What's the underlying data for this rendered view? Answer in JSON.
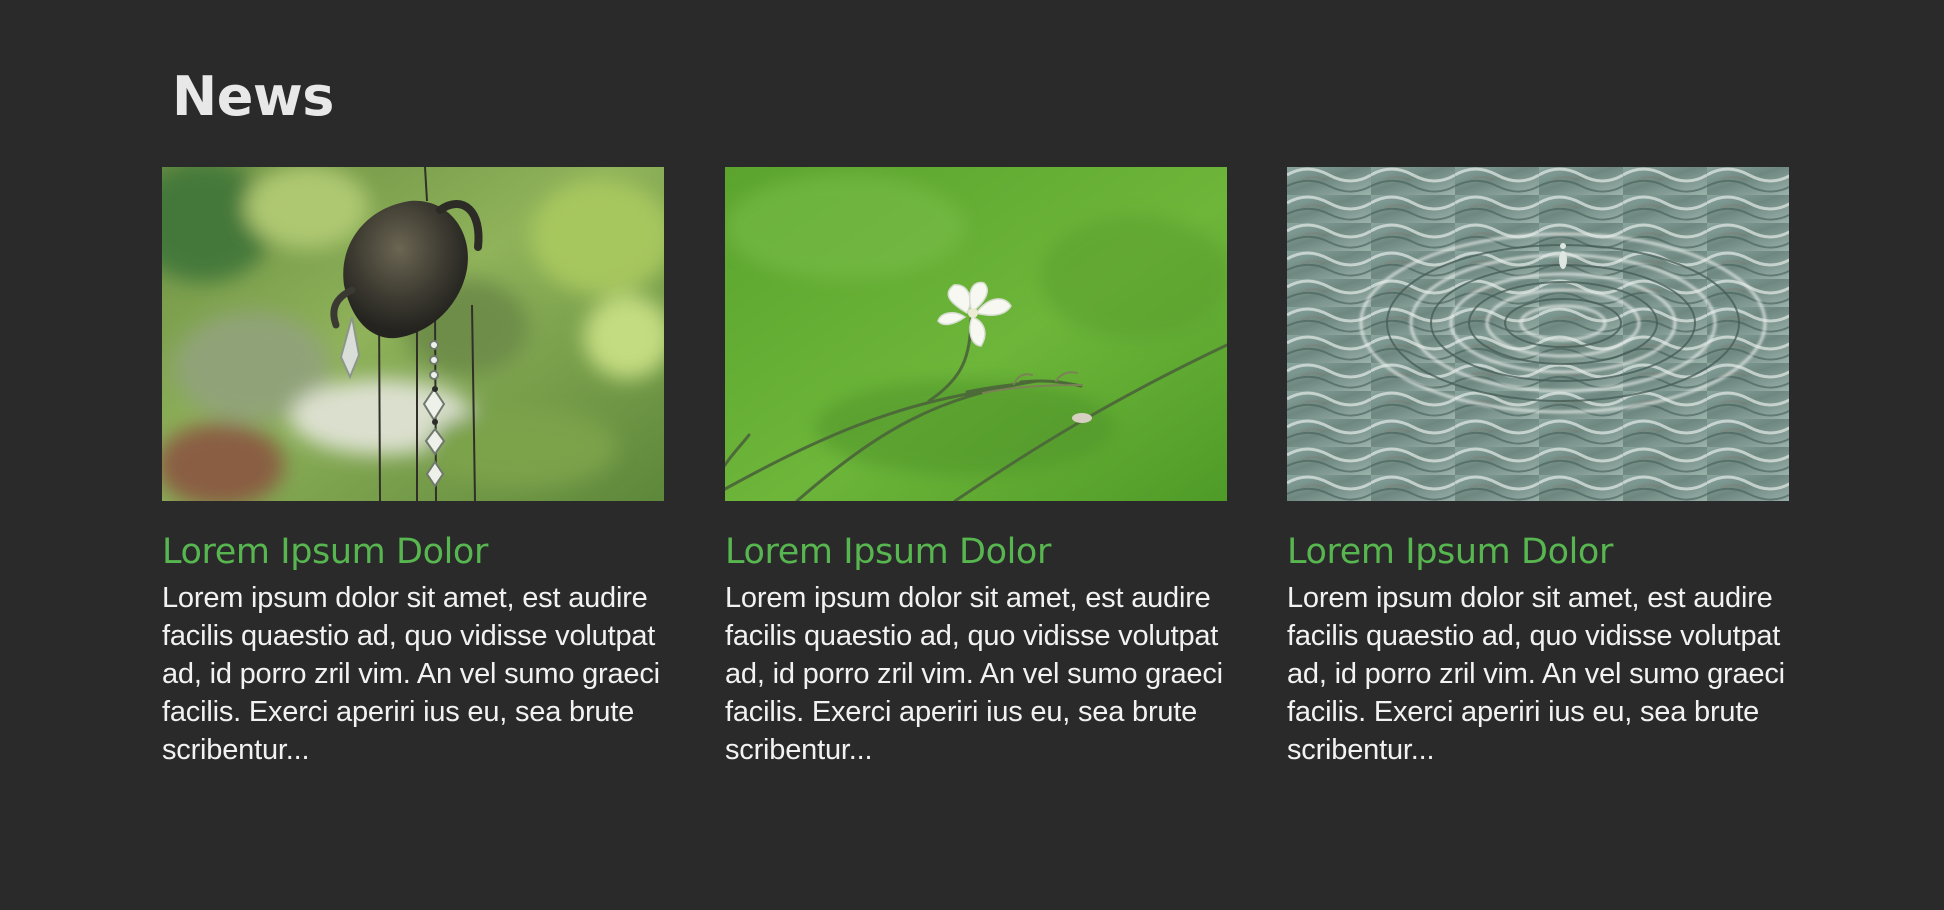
{
  "section": {
    "title": "News"
  },
  "articles": [
    {
      "image_icon": "wind-chime-photo",
      "title": "Lorem Ipsum Dolor",
      "excerpt": "Lorem ipsum dolor sit amet, est audire facilis quaestio ad, quo vidisse volutpat ad, id porro zril vim. An vel sumo graeci facilis. Exerci aperiri ius eu, sea brute scribentur..."
    },
    {
      "image_icon": "white-flower-photo",
      "title": "Lorem Ipsum Dolor",
      "excerpt": "Lorem ipsum dolor sit amet, est audire facilis quaestio ad, quo vidisse volutpat ad, id porro zril vim. An vel sumo graeci facilis. Exerci aperiri ius eu, sea brute scribentur..."
    },
    {
      "image_icon": "water-ripples-photo",
      "title": "Lorem Ipsum Dolor",
      "excerpt": "Lorem ipsum dolor sit amet, est audire facilis quaestio ad, quo vidisse volutpat ad, id porro zril vim. An vel sumo graeci facilis. Exerci aperiri ius eu, sea brute scribentur..."
    }
  ],
  "colors": {
    "background": "#2a2a2a",
    "heading": "#e8e8e8",
    "accent": "#57b64f",
    "body_text": "#f2f2f2"
  }
}
